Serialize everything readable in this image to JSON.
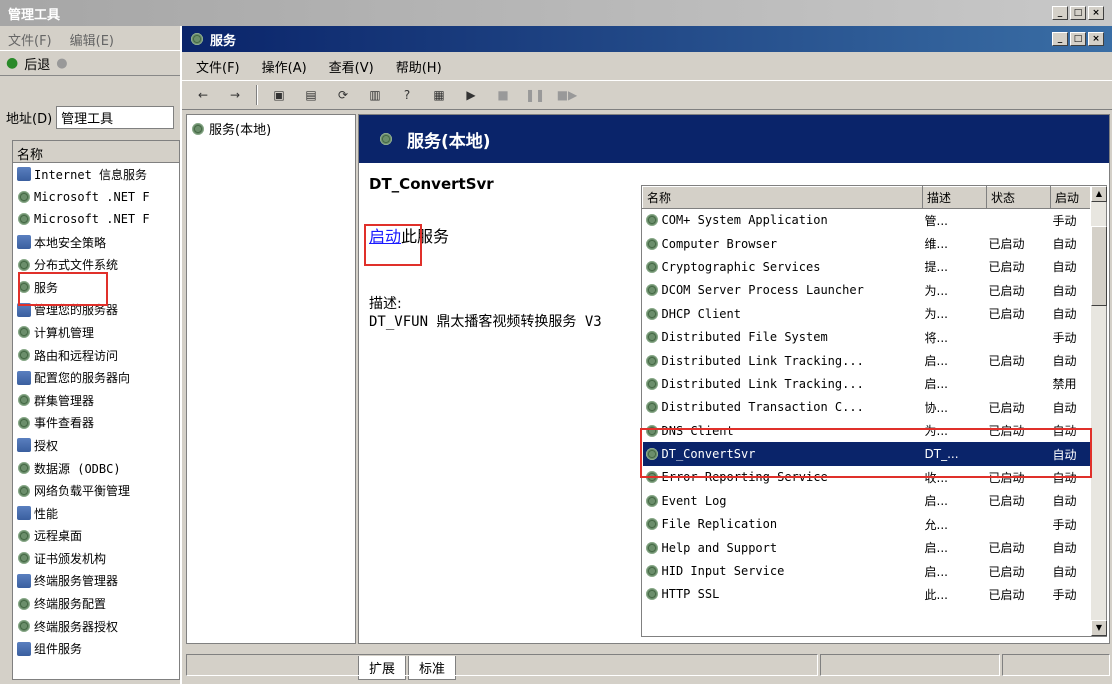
{
  "back_window": {
    "title": "管理工具",
    "menu": [
      "文件(F)",
      "编辑(E)"
    ],
    "nav_back": "后退",
    "address_label": "地址(D)",
    "address_value": "管理工具",
    "list_header": "名称",
    "items": [
      "Internet 信息服务",
      "Microsoft .NET F",
      "Microsoft .NET F",
      "本地安全策略",
      "分布式文件系统",
      "服务",
      "管理您的服务器",
      "计算机管理",
      "路由和远程访问",
      "配置您的服务器向",
      "群集管理器",
      "事件查看器",
      "授权",
      "数据源 (ODBC)",
      "网络负载平衡管理",
      "性能",
      "远程桌面",
      "证书颁发机构",
      "终端服务管理器",
      "终端服务配置",
      "终端服务器授权",
      "组件服务"
    ]
  },
  "front_window": {
    "title": "服务",
    "menu": [
      "文件(F)",
      "操作(A)",
      "查看(V)",
      "帮助(H)"
    ],
    "tree_root": "服务(本地)",
    "panel_title": "服务(本地)",
    "selected_service": "DT_ConvertSvr",
    "action_link": "启动",
    "action_rest": "此服务",
    "desc_label": "描述:",
    "desc_text": "DT_VFUN 鼎太播客视频转换服务 V3",
    "columns": [
      "名称",
      "描述",
      "状态",
      "启动"
    ],
    "rows": [
      {
        "name": "COM+ System Application",
        "desc": "管...",
        "status": "",
        "startup": "手动"
      },
      {
        "name": "Computer Browser",
        "desc": "维...",
        "status": "已启动",
        "startup": "自动"
      },
      {
        "name": "Cryptographic Services",
        "desc": "提...",
        "status": "已启动",
        "startup": "自动"
      },
      {
        "name": "DCOM Server Process Launcher",
        "desc": "为...",
        "status": "已启动",
        "startup": "自动"
      },
      {
        "name": "DHCP Client",
        "desc": "为...",
        "status": "已启动",
        "startup": "自动"
      },
      {
        "name": "Distributed File System",
        "desc": "将...",
        "status": "",
        "startup": "手动"
      },
      {
        "name": "Distributed Link Tracking...",
        "desc": "启...",
        "status": "已启动",
        "startup": "自动"
      },
      {
        "name": "Distributed Link Tracking...",
        "desc": "启...",
        "status": "",
        "startup": "禁用"
      },
      {
        "name": "Distributed Transaction C...",
        "desc": "协...",
        "status": "已启动",
        "startup": "自动"
      },
      {
        "name": "DNS Client",
        "desc": "为...",
        "status": "已启动",
        "startup": "自动"
      },
      {
        "name": "DT_ConvertSvr",
        "desc": "DT_...",
        "status": "",
        "startup": "自动"
      },
      {
        "name": "Error Reporting Service",
        "desc": "收...",
        "status": "已启动",
        "startup": "自动"
      },
      {
        "name": "Event Log",
        "desc": "启...",
        "status": "已启动",
        "startup": "自动"
      },
      {
        "name": "File Replication",
        "desc": "允...",
        "status": "",
        "startup": "手动"
      },
      {
        "name": "Help and Support",
        "desc": "启...",
        "status": "已启动",
        "startup": "自动"
      },
      {
        "name": "HID Input Service",
        "desc": "启...",
        "status": "已启动",
        "startup": "自动"
      },
      {
        "name": "HTTP SSL",
        "desc": "此...",
        "status": "已启动",
        "startup": "手动"
      }
    ],
    "selected_row_index": 10,
    "tabs": [
      "扩展",
      "标准"
    ]
  },
  "colors": {
    "titlebar_active": "#0a246a",
    "highlight": "#e0302a",
    "selection": "#0a246a"
  }
}
